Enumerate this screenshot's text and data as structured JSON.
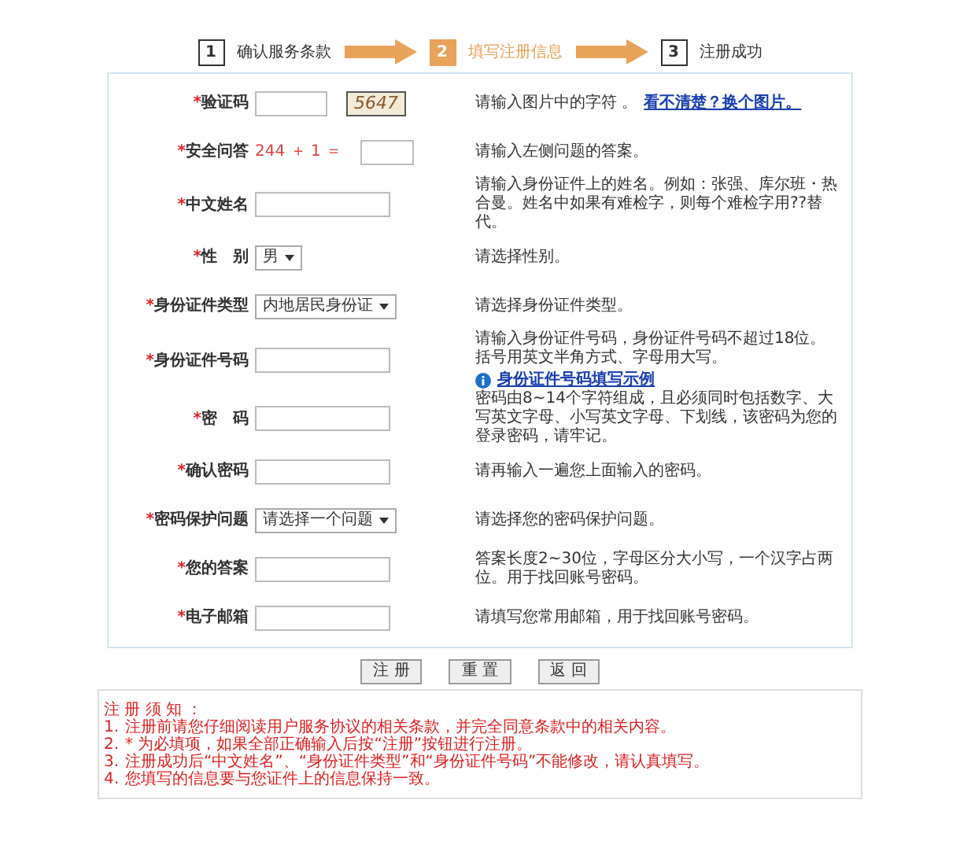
{
  "steps": [
    {
      "number": "1",
      "label": "确认服务条款",
      "selected": false
    },
    {
      "number": "2",
      "label": "填写注册信息",
      "selected": true
    },
    {
      "number": "3",
      "label": "注册成功",
      "selected": false
    }
  ],
  "fields": [
    {
      "required_mark": "*",
      "label": "验证码",
      "kind": "captcha",
      "captcha": "5647",
      "hint": "请输入图片中的字符 。",
      "link": "看不清楚？换个图片。"
    },
    {
      "required_mark": "*",
      "label": "安全问答",
      "kind": "math",
      "question": "244 ＋ 1 ＝",
      "hint": "请输入左侧问题的答案。"
    },
    {
      "required_mark": "*",
      "label": "中文姓名",
      "kind": "input",
      "hint": "请输入身份证件上的姓名。例如：张强、库尔班・热合曼。姓名中如果有难检字，则每个难检字用??替代。"
    },
    {
      "required_mark": "*",
      "label": "性　别",
      "kind": "select",
      "value": "男",
      "hint": "请选择性别。"
    },
    {
      "required_mark": "*",
      "label": "身份证件类型",
      "kind": "select",
      "value": "内地居民身份证",
      "hint": "请选择身份证件类型。"
    },
    {
      "required_mark": "*",
      "label": "身份证件号码",
      "kind": "input",
      "hint": "请输入身份证件号码，身份证件号码不超过18位。括号用英文半角方式、字母用大写。",
      "info_link": "身份证件号码填写示例"
    },
    {
      "required_mark": "*",
      "label": "密　码",
      "kind": "input",
      "hint": "密码由8~14个字符组成，且必须同时包括数字、大写英文字母、小写英文字母、下划线，该密码为您的登录密码，请牢记。"
    },
    {
      "required_mark": "*",
      "label": "确认密码",
      "kind": "input",
      "hint": "请再输入一遍您上面输入的密码。"
    },
    {
      "required_mark": "*",
      "label": "密码保护问题",
      "kind": "select",
      "value": "请选择一个问题",
      "hint": "请选择您的密码保护问题。"
    },
    {
      "required_mark": "*",
      "label": "您的答案",
      "kind": "input",
      "hint": "答案长度2~30位，字母区分大小写，一个汉字占两位。用于找回账号密码。"
    },
    {
      "required_mark": "*",
      "label": "电子邮箱",
      "kind": "input",
      "hint": "请填写您常用邮箱，用于找回账号密码。"
    }
  ],
  "buttons": [
    "注 册",
    "重 置",
    "返 回"
  ],
  "notice": {
    "title": "注 册 须 知 ：",
    "items": [
      {
        "number": "1.",
        "text": "注册前请您仔细阅读用户服务协议的相关条款，并完全同意条款中的相关内容。"
      },
      {
        "number": "2.",
        "text": "* 为必填项，如果全部正确输入后按“注册”按钮进行注册。"
      },
      {
        "number": "3.",
        "text": "注册成功后“中文姓名”、“身份证件类型”和“身份证件号码”不能修改，请认真填写。"
      },
      {
        "number": "4.",
        "text": "您填写的信息要与您证件上的信息保持一致。"
      }
    ]
  }
}
